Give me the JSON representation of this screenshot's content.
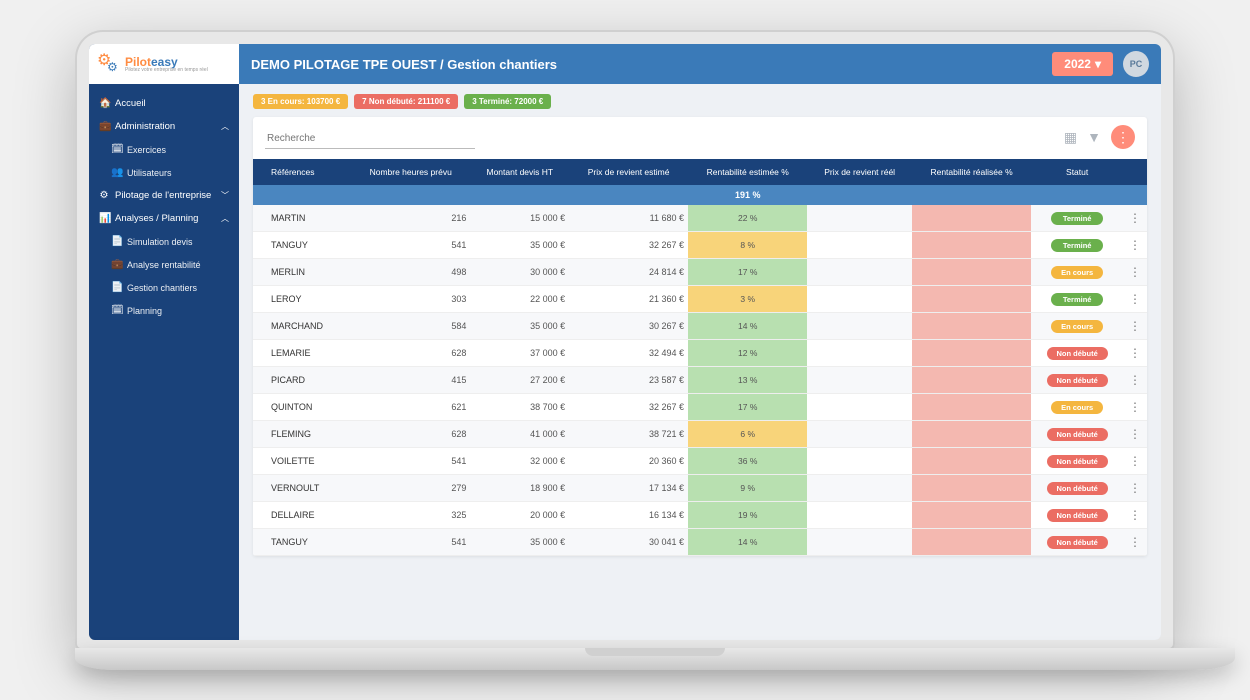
{
  "logo": {
    "brand_a": "Pilot",
    "brand_b": "easy",
    "tag": "Pilotez votre entreprise en temps réel"
  },
  "breadcrumb": "DEMO PILOTAGE TPE OUEST / Gestion chantiers",
  "year": "2022",
  "avatar": "PC",
  "nav": {
    "accueil": "Accueil",
    "admin": "Administration",
    "exercices": "Exercices",
    "users": "Utilisateurs",
    "pilotage": "Pilotage de l'entreprise",
    "analyses": "Analyses / Planning",
    "sim": "Simulation devis",
    "renta": "Analyse rentabilité",
    "gestion": "Gestion chantiers",
    "planning": "Planning"
  },
  "pills": {
    "encours": "3 En cours: 103700 €",
    "nondebute": "7 Non débuté: 211100 €",
    "termine": "3 Terminé: 72000 €"
  },
  "search_ph": "Recherche",
  "cols": {
    "ref": "Références",
    "hrs": "Nombre heures prévu",
    "devis": "Montant devis HT",
    "prix_est": "Prix de revient estimé",
    "rent_est": "Rentabilité estimée %",
    "prix_reel": "Prix de revient réél",
    "rent_reel": "Rentabilité réalisée %",
    "statut": "Statut"
  },
  "summary_rent": "191 %",
  "status_labels": {
    "termine": "Terminé",
    "encours": "En cours",
    "nondebute": "Non débuté"
  },
  "rows": [
    {
      "ref": "MARTIN",
      "hrs": "216",
      "devis": "15 000 €",
      "prix": "11 680 €",
      "rent": "22 %",
      "rc": "g",
      "st": "termine",
      "sc": "g"
    },
    {
      "ref": "TANGUY",
      "hrs": "541",
      "devis": "35 000 €",
      "prix": "32 267 €",
      "rent": "8 %",
      "rc": "y",
      "st": "termine",
      "sc": "g"
    },
    {
      "ref": "MERLIN",
      "hrs": "498",
      "devis": "30 000 €",
      "prix": "24 814 €",
      "rent": "17 %",
      "rc": "g",
      "st": "encours",
      "sc": "y"
    },
    {
      "ref": "LEROY",
      "hrs": "303",
      "devis": "22 000 €",
      "prix": "21 360 €",
      "rent": "3 %",
      "rc": "y",
      "st": "termine",
      "sc": "g"
    },
    {
      "ref": "MARCHAND",
      "hrs": "584",
      "devis": "35 000 €",
      "prix": "30 267 €",
      "rent": "14 %",
      "rc": "g",
      "st": "encours",
      "sc": "y"
    },
    {
      "ref": "LEMARIE",
      "hrs": "628",
      "devis": "37 000 €",
      "prix": "32 494 €",
      "rent": "12 %",
      "rc": "g",
      "st": "nondebute",
      "sc": "r"
    },
    {
      "ref": "PICARD",
      "hrs": "415",
      "devis": "27 200 €",
      "prix": "23 587 €",
      "rent": "13 %",
      "rc": "g",
      "st": "nondebute",
      "sc": "r"
    },
    {
      "ref": "QUINTON",
      "hrs": "621",
      "devis": "38 700 €",
      "prix": "32 267 €",
      "rent": "17 %",
      "rc": "g",
      "st": "encours",
      "sc": "y"
    },
    {
      "ref": "FLEMING",
      "hrs": "628",
      "devis": "41 000 €",
      "prix": "38 721 €",
      "rent": "6 %",
      "rc": "y",
      "st": "nondebute",
      "sc": "r"
    },
    {
      "ref": "VOILETTE",
      "hrs": "541",
      "devis": "32 000 €",
      "prix": "20 360 €",
      "rent": "36 %",
      "rc": "g",
      "st": "nondebute",
      "sc": "r"
    },
    {
      "ref": "VERNOULT",
      "hrs": "279",
      "devis": "18 900 €",
      "prix": "17 134 €",
      "rent": "9 %",
      "rc": "g",
      "st": "nondebute",
      "sc": "r"
    },
    {
      "ref": "DELLAIRE",
      "hrs": "325",
      "devis": "20 000 €",
      "prix": "16 134 €",
      "rent": "19 %",
      "rc": "g",
      "st": "nondebute",
      "sc": "r"
    },
    {
      "ref": "TANGUY",
      "hrs": "541",
      "devis": "35 000 €",
      "prix": "30 041 €",
      "rent": "14 %",
      "rc": "g",
      "st": "nondebute",
      "sc": "r"
    }
  ]
}
